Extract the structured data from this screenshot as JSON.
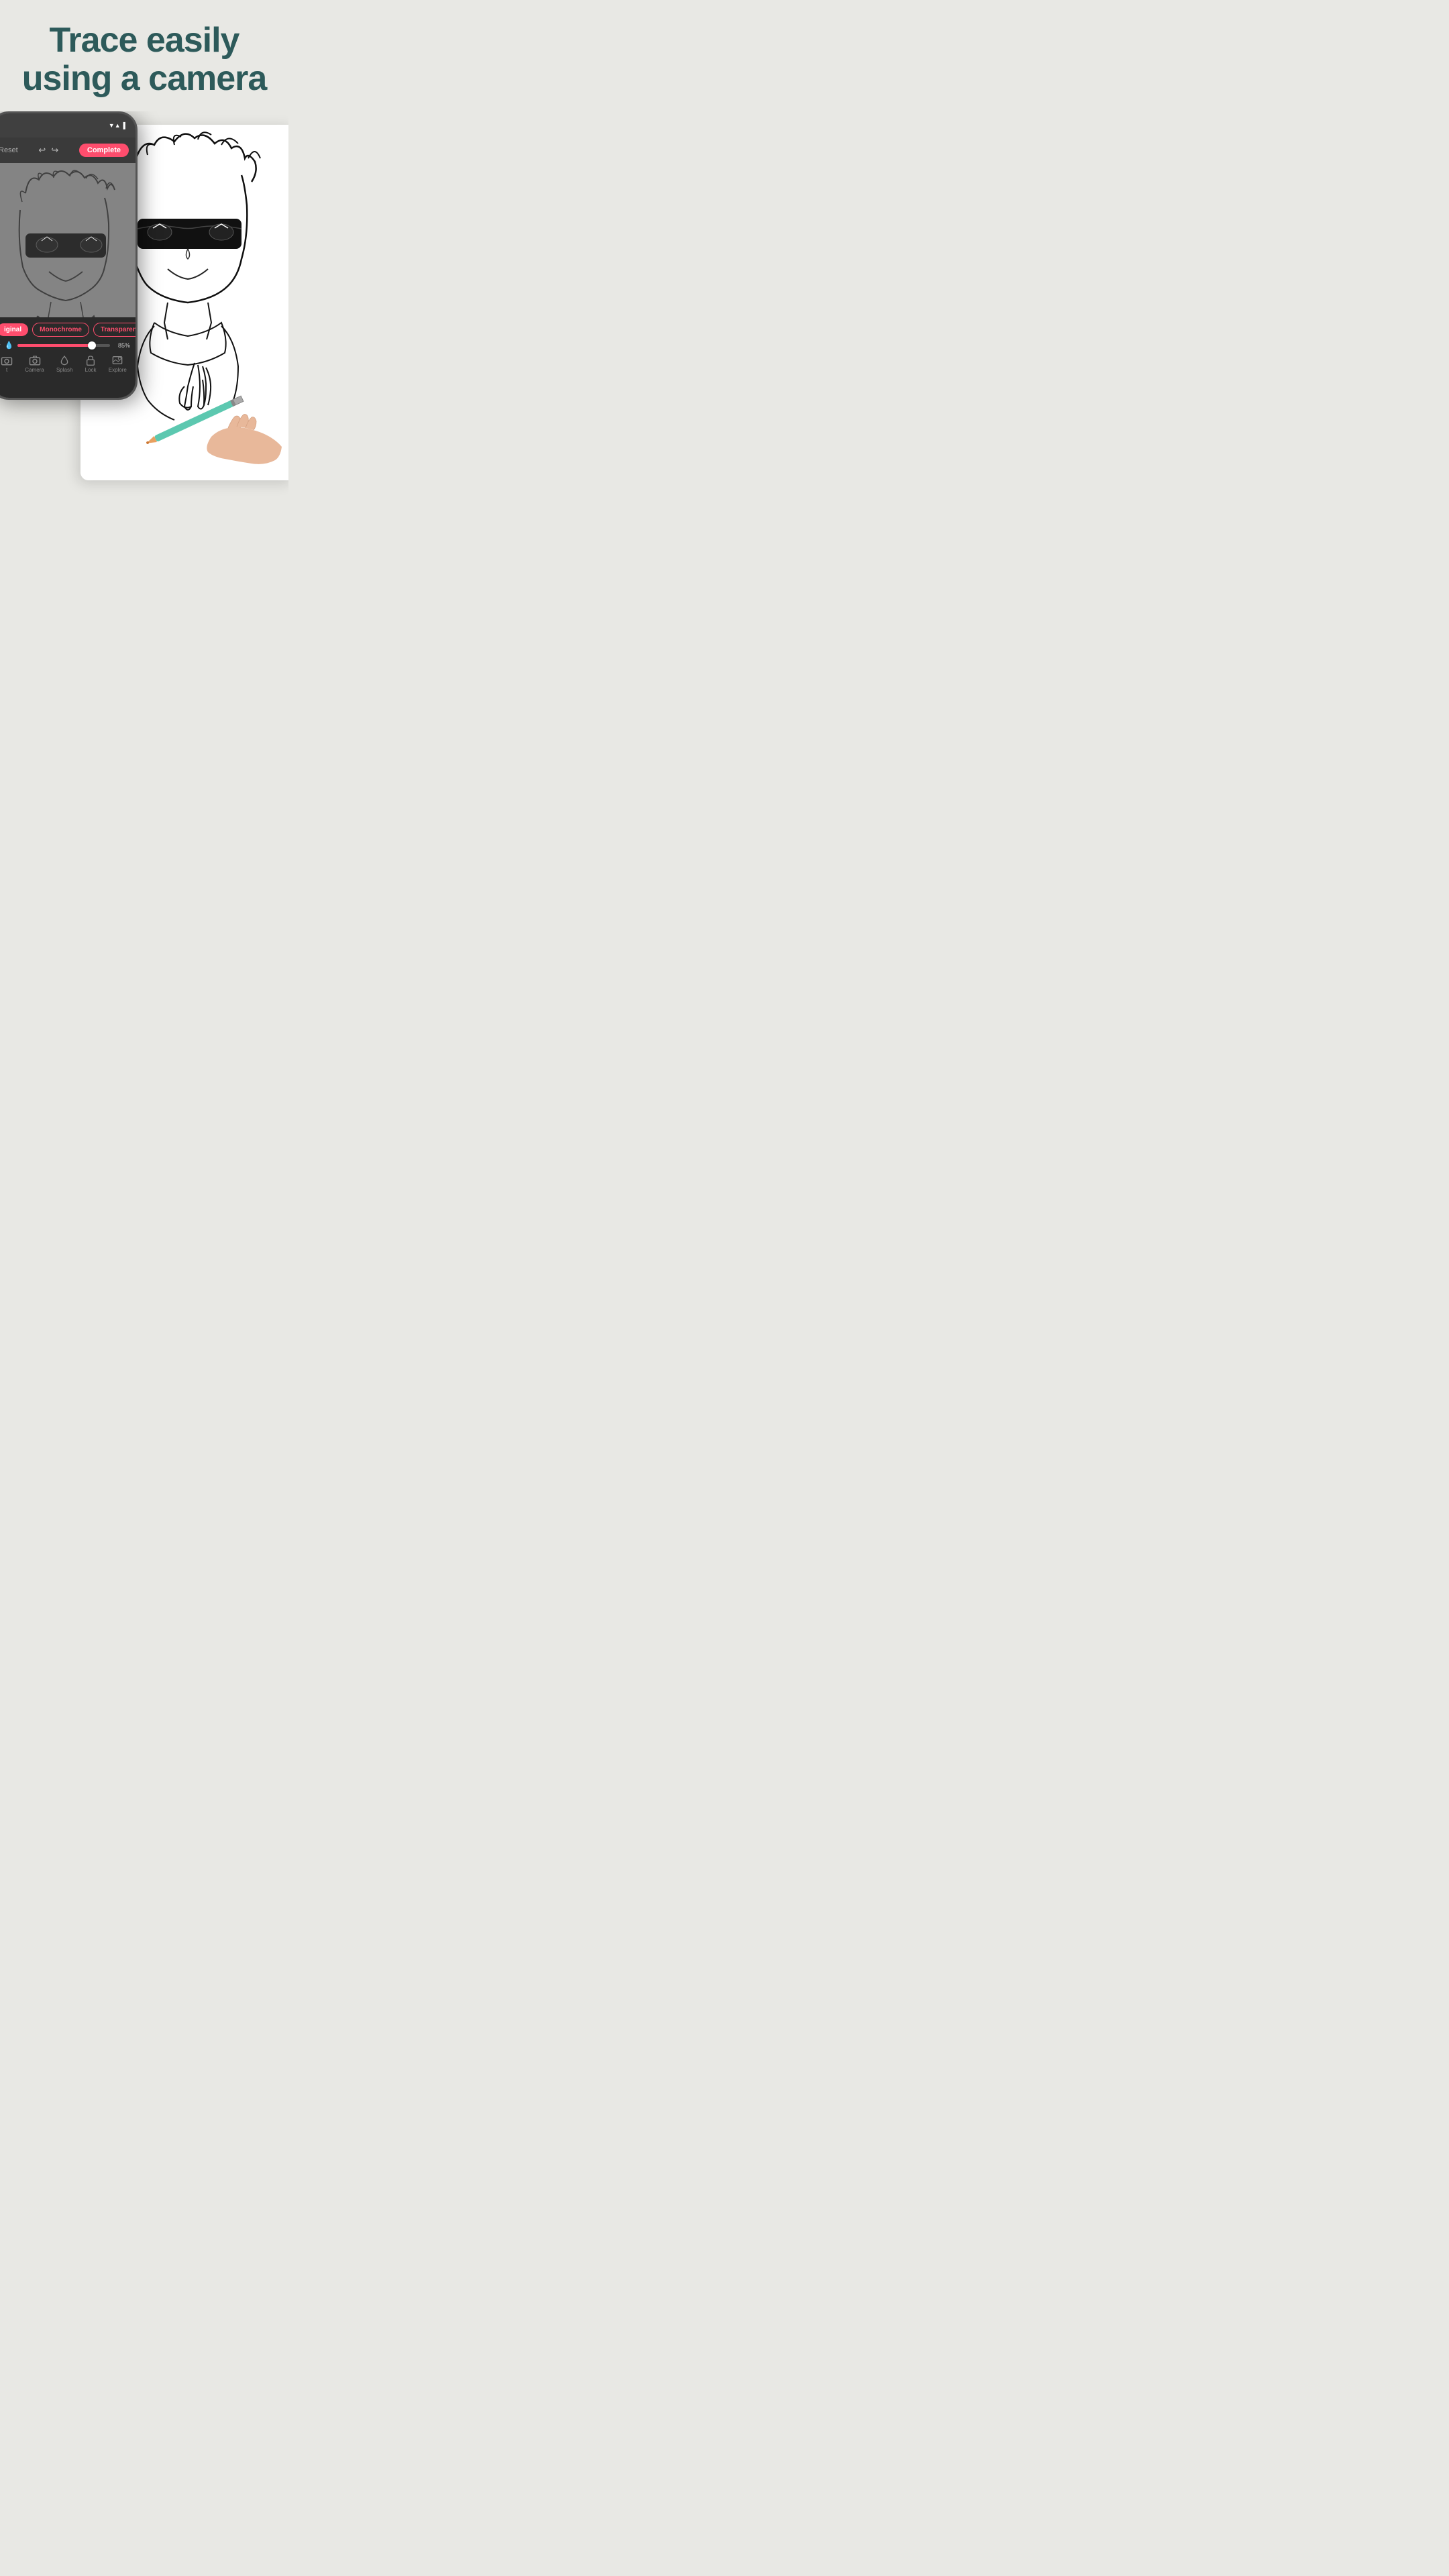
{
  "header": {
    "line1": "Trace easily",
    "line2": "using a camera"
  },
  "phone": {
    "topbar": {
      "signal": "▼▲",
      "battery": "▌"
    },
    "toolbar": {
      "reset_label": "Reset",
      "complete_label": "Complete"
    },
    "filters": [
      {
        "label": "iginal",
        "active": true
      },
      {
        "label": "Monochrome",
        "active": false
      },
      {
        "label": "Transparent",
        "active": false
      }
    ],
    "slider": {
      "value_label": "85%",
      "fill_percent": 85
    },
    "nav_items": [
      {
        "label": "t",
        "icon": "camera",
        "active": false
      },
      {
        "label": "Camera",
        "icon": "camera",
        "active": false
      },
      {
        "label": "Splash",
        "icon": "splash",
        "active": false
      },
      {
        "label": "Lock",
        "icon": "lock",
        "active": false
      },
      {
        "label": "Explore",
        "icon": "explore",
        "active": false
      }
    ]
  },
  "colors": {
    "accent": "#ff4d6d",
    "bg": "#e8e8e4",
    "text_dark": "#2d5a5a",
    "phone_bg": "#3a3a3a"
  }
}
